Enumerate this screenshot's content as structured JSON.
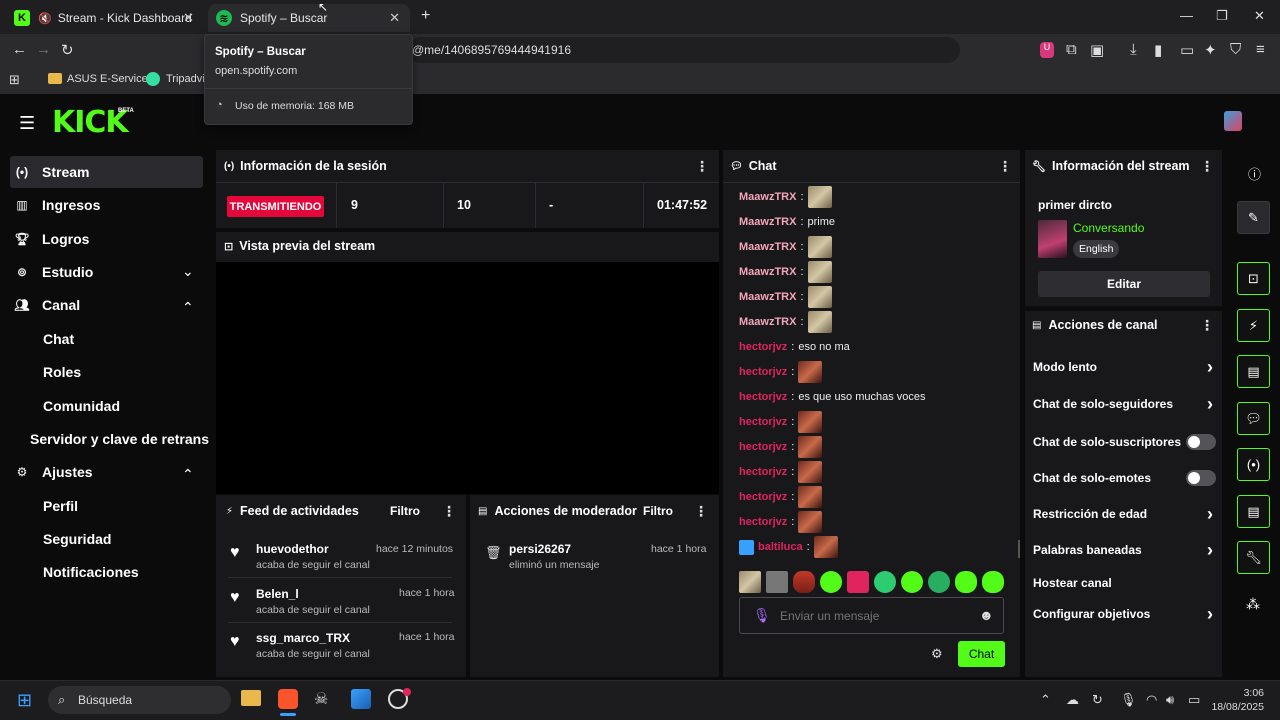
{
  "browser": {
    "tabs": [
      {
        "title": "Stream - Kick Dashboard",
        "active": false
      },
      {
        "title": "Spotify – Buscar",
        "active": true
      }
    ],
    "address": "@me/1406895769444941916",
    "bookmarks": [
      "ASUS E-Service",
      "Tripadvis"
    ],
    "tooltip": {
      "title": "Spotify – Buscar",
      "url": "open.spotify.com",
      "memory": "Uso de memoria: 168 MB"
    }
  },
  "kick": {
    "logo": "KICK",
    "beta": "BETA",
    "accent": "#53fc18"
  },
  "sidebar": {
    "items": [
      {
        "label": "Stream",
        "icon": "broadcast-icon"
      },
      {
        "label": "Ingresos",
        "icon": "chart-icon"
      },
      {
        "label": "Logros",
        "icon": "trophy-icon"
      },
      {
        "label": "Estudio",
        "icon": "studio-icon"
      },
      {
        "label": "Canal",
        "icon": "people-icon"
      },
      {
        "label": "Ajustes",
        "icon": "gear-icon"
      }
    ],
    "canal_sub": [
      "Chat",
      "Roles",
      "Comunidad"
    ],
    "servidor": "Servidor y clave de retrans",
    "ajustes_sub": [
      "Perfil",
      "Seguridad",
      "Notificaciones"
    ]
  },
  "session": {
    "title": "Información de la sesión",
    "status": "TRANSMITIENDO",
    "stat1": "9",
    "stat2": "10",
    "stat3": "-",
    "duration": "01:47:52"
  },
  "preview": {
    "title": "Vista previa del stream"
  },
  "feed": {
    "title": "Feed de actividades",
    "filter": "Filtro",
    "items": [
      {
        "user": "huevodethor",
        "time": "hace 12 minutos",
        "action": "acaba de seguir el canal"
      },
      {
        "user": "Belen_l",
        "time": "hace 1 hora",
        "action": "acaba de seguir el canal"
      },
      {
        "user": "ssg_marco_TRX",
        "time": "hace 1 hora",
        "action": "acaba de seguir el canal"
      }
    ]
  },
  "mod": {
    "title": "Acciones de moderador",
    "filter": "Filtro",
    "items": [
      {
        "user": "persi26267",
        "time": "hace 1 hora",
        "action": "eliminó un mensaje"
      }
    ]
  },
  "chat": {
    "title": "Chat",
    "messages": [
      {
        "user": "MaawzTRX",
        "text": "",
        "emote": "a",
        "color": "#f4a6b8"
      },
      {
        "user": "MaawzTRX",
        "text": "prime",
        "emote": "",
        "color": "#f4a6b8"
      },
      {
        "user": "MaawzTRX",
        "text": "",
        "emote": "a",
        "color": "#f4a6b8"
      },
      {
        "user": "MaawzTRX",
        "text": "",
        "emote": "a",
        "color": "#f4a6b8"
      },
      {
        "user": "MaawzTRX",
        "text": "",
        "emote": "a",
        "color": "#f4a6b8"
      },
      {
        "user": "MaawzTRX",
        "text": "",
        "emote": "a",
        "color": "#f4a6b8"
      },
      {
        "user": "hectorjvz",
        "text": "eso no ma",
        "emote": "",
        "color": "#e0245e"
      },
      {
        "user": "hectorjvz",
        "text": "",
        "emote": "b",
        "color": "#e0245e"
      },
      {
        "user": "hectorjvz",
        "text": "es que uso muchas voces",
        "emote": "",
        "color": "#e0245e"
      },
      {
        "user": "hectorjvz",
        "text": "",
        "emote": "b",
        "color": "#e0245e"
      },
      {
        "user": "hectorjvz",
        "text": "",
        "emote": "b",
        "color": "#e0245e"
      },
      {
        "user": "hectorjvz",
        "text": "",
        "emote": "b",
        "color": "#e0245e"
      },
      {
        "user": "hectorjvz",
        "text": "",
        "emote": "b",
        "color": "#e0245e"
      },
      {
        "user": "hectorjvz",
        "text": "",
        "emote": "b",
        "color": "#e0245e"
      },
      {
        "user": "baltiluca",
        "text": "",
        "emote": "b",
        "color": "#e0245e"
      }
    ],
    "placeholder": "Enviar un mensaje",
    "send": "Chat"
  },
  "stream_info": {
    "title": "Información del stream",
    "stream_title": "primer dircto",
    "category": "Conversando",
    "language": "English",
    "edit": "Editar"
  },
  "channel_actions": {
    "title": "Acciones de canal",
    "items": [
      {
        "label": "Modo lento",
        "kind": "arrow"
      },
      {
        "label": "Chat de solo-seguidores",
        "kind": "arrow"
      },
      {
        "label": "Chat de solo-suscriptores",
        "kind": "toggle"
      },
      {
        "label": "Chat de solo-emotes",
        "kind": "toggle"
      },
      {
        "label": "Restricción de edad",
        "kind": "arrow"
      },
      {
        "label": "Palabras baneadas",
        "kind": "arrow"
      },
      {
        "label": "Hostear canal",
        "kind": "none"
      },
      {
        "label": "Configurar objetivos",
        "kind": "arrow"
      }
    ]
  },
  "taskbar": {
    "search": "Búsqueda",
    "time": "3:06",
    "date": "18/08/2025"
  }
}
